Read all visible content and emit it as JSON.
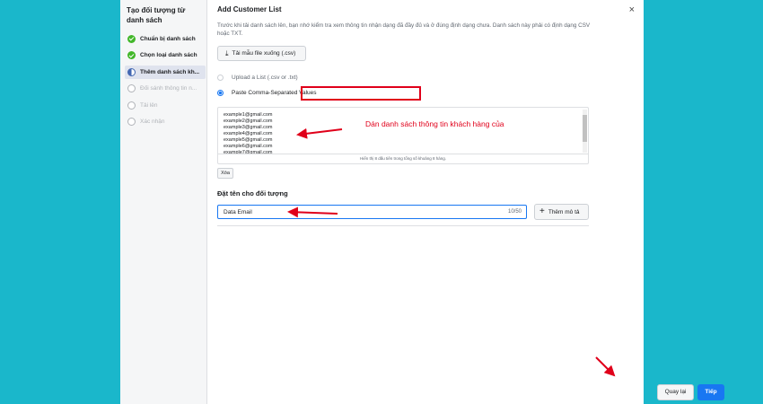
{
  "sidebar": {
    "title": "Tạo đối tượng từ danh sách",
    "steps": [
      {
        "label": "Chuẩn bị danh sách",
        "icon": "check-circle-icon"
      },
      {
        "label": "Chọn loại danh sách",
        "icon": "check-circle-icon"
      },
      {
        "label": "Thêm danh sách kh...",
        "icon": "half-circle-icon"
      },
      {
        "label": "Đối sánh thông tin n...",
        "icon": "empty-circle-icon"
      },
      {
        "label": "Tải lên",
        "icon": "empty-circle-icon"
      },
      {
        "label": "Xác nhận",
        "icon": "empty-circle-icon"
      }
    ]
  },
  "dialog": {
    "title": "Add Customer List",
    "close_icon": "×",
    "description": "Trước khi tải danh sách lên, bạn nhớ kiểm tra xem thông tin nhận dạng đã đầy đủ và ở đúng định dạng chưa. Danh sách này phải có định dạng CSV hoặc TXT.",
    "template_button": "Tải mẫu file xuống (.csv)",
    "download_icon": "⤓",
    "options": [
      {
        "label": "Upload a List (.csv or .txt)",
        "selected": false
      },
      {
        "label": "Paste Comma-Separated Values",
        "selected": true
      }
    ],
    "emails": [
      "example1@gmail.com",
      "example2@gmail.com",
      "example3@gmail.com",
      "example4@gmail.com",
      "example5@gmail.com",
      "example6@gmail.com",
      "example7@gmail.com"
    ],
    "preview_note": "Hiển thị 8 dấu tiên trong tổng số khoảng 8 hàng.",
    "clear_button": "Xóa",
    "name_section_title": "Đặt tên cho đối tượng",
    "name_value": "Data Email",
    "name_counter": "10/50",
    "add_description_button": "Thêm mô tả",
    "plus_icon": "+",
    "back_button": "Quay lại",
    "next_button": "Tiếp"
  },
  "annotations": {
    "textarea_note": "Dán danh sách thông tin khách hàng của",
    "color": "#e0001a"
  },
  "colors": {
    "background": "#1ab7cb",
    "primary": "#1877f2",
    "success": "#42b72a"
  }
}
